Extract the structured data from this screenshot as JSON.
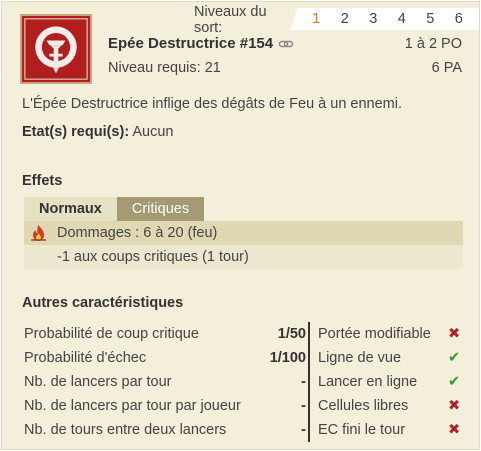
{
  "header": {
    "levels_label": "Niveaux du sort:",
    "levels": [
      "1",
      "2",
      "3",
      "4",
      "5",
      "6"
    ],
    "active_level_index": 0,
    "spell_name": "Epée Destructrice #154",
    "required_level": "Niveau requis: 21",
    "range": "1 à 2 PO",
    "ap_cost": "6 PA",
    "icon": "sword-spell-icon"
  },
  "description": "L'Épée Destructrice inflige des dégâts de Feu à un ennemi.",
  "states": {
    "label": "Etat(s) requi(s):",
    "value": " Aucun"
  },
  "effects": {
    "title": "Effets",
    "tabs": [
      "Normaux",
      "Critiques"
    ],
    "active_tab_index": 0,
    "rows": [
      {
        "text": "Dommages : 6 à 20 (feu)",
        "icon": "fire-element-icon"
      },
      {
        "text": "-1 aux coups critiques (1 tour)"
      }
    ]
  },
  "characteristics": {
    "title": "Autres caractéristiques",
    "rows": [
      {
        "label": "Probabilité de coup critique",
        "value": "1/50",
        "right_label": "Portée modifiable",
        "right_mark": "✖",
        "right_ok": false
      },
      {
        "label": "Probabilité d'échec",
        "value": "1/100",
        "right_label": "Ligne de vue",
        "right_mark": "✔",
        "right_ok": true
      },
      {
        "label": "Nb. de lancers par tour",
        "value": "-",
        "right_label": "Lancer en ligne",
        "right_mark": "✔",
        "right_ok": true
      },
      {
        "label": "Nb. de lancers par tour par joueur",
        "value": "-",
        "right_label": "Cellules libres",
        "right_mark": "✖",
        "right_ok": false
      },
      {
        "label": "Nb. de tours entre deux lancers",
        "value": "-",
        "right_label": "EC fini le tour",
        "right_mark": "✖",
        "right_ok": false
      }
    ]
  },
  "colors": {
    "background": "#f3efdb",
    "active_level": "#e0733c",
    "tab_inactive": "#a49b72",
    "check": "#3c9a1e",
    "cross": "#b4232a"
  }
}
